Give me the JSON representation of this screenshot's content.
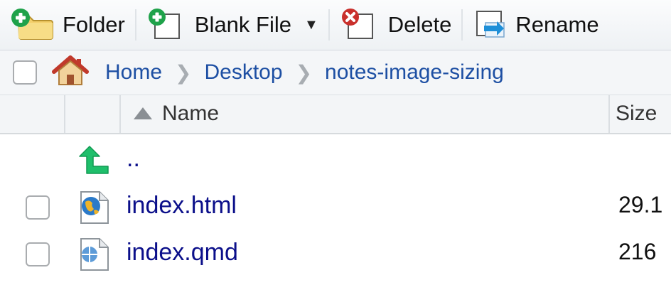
{
  "toolbar": {
    "folder_label": "Folder",
    "blank_file_label": "Blank File",
    "delete_label": "Delete",
    "rename_label": "Rename"
  },
  "breadcrumb": {
    "home": "Home",
    "items": [
      "Desktop",
      "notes-image-sizing"
    ]
  },
  "columns": {
    "name": "Name",
    "size": "Size"
  },
  "files": [
    {
      "name": "..",
      "size": "",
      "icon": "up-arrow-icon"
    },
    {
      "name": "index.html",
      "size": "29.1",
      "icon": "html-file-icon"
    },
    {
      "name": "index.qmd",
      "size": "216",
      "icon": "quarto-file-icon"
    }
  ],
  "colors": {
    "link": "#0b0f8a",
    "breadcrumb": "#1d4fa3",
    "add_green": "#1fa24a",
    "delete_red": "#c9302c"
  }
}
